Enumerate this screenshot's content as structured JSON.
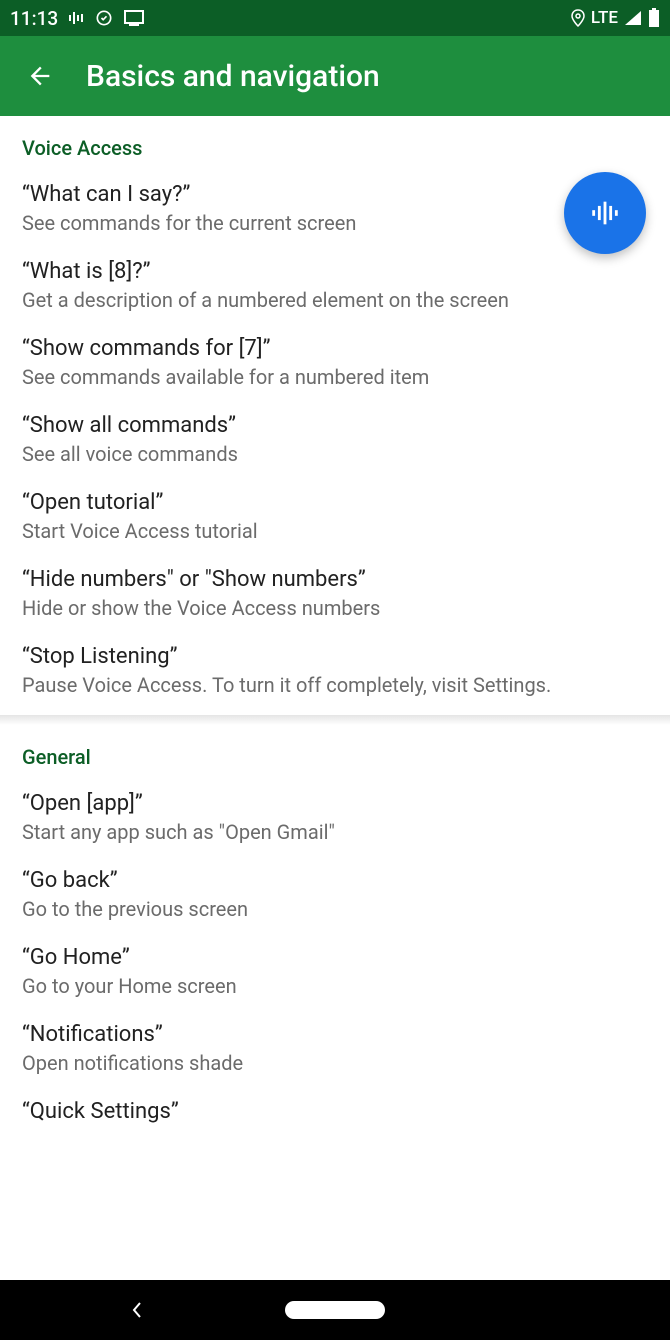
{
  "status": {
    "time": "11:13",
    "network": "LTE"
  },
  "header": {
    "title": "Basics and navigation"
  },
  "sections": [
    {
      "title": "Voice Access",
      "items": [
        {
          "title": "“What can I say?”",
          "sub": "See commands for the current screen"
        },
        {
          "title": "“What is [8]?”",
          "sub": "Get a description of a numbered element on the screen"
        },
        {
          "title": "“Show commands for [7]”",
          "sub": "See commands available for a numbered item"
        },
        {
          "title": "“Show all commands”",
          "sub": "See all voice commands"
        },
        {
          "title": "“Open tutorial”",
          "sub": "Start Voice Access tutorial"
        },
        {
          "title": "“Hide numbers\" or \"Show numbers”",
          "sub": "Hide or show the Voice Access numbers"
        },
        {
          "title": "“Stop Listening”",
          "sub": "Pause Voice Access. To turn it off completely, visit Settings."
        }
      ]
    },
    {
      "title": "General",
      "items": [
        {
          "title": "“Open [app]”",
          "sub": "Start any app such as \"Open Gmail\""
        },
        {
          "title": "“Go back”",
          "sub": "Go to the previous screen"
        },
        {
          "title": "“Go Home”",
          "sub": "Go to your Home screen"
        },
        {
          "title": "“Notifications”",
          "sub": "Open notifications shade"
        },
        {
          "title": "“Quick Settings”",
          "sub": ""
        }
      ]
    }
  ]
}
